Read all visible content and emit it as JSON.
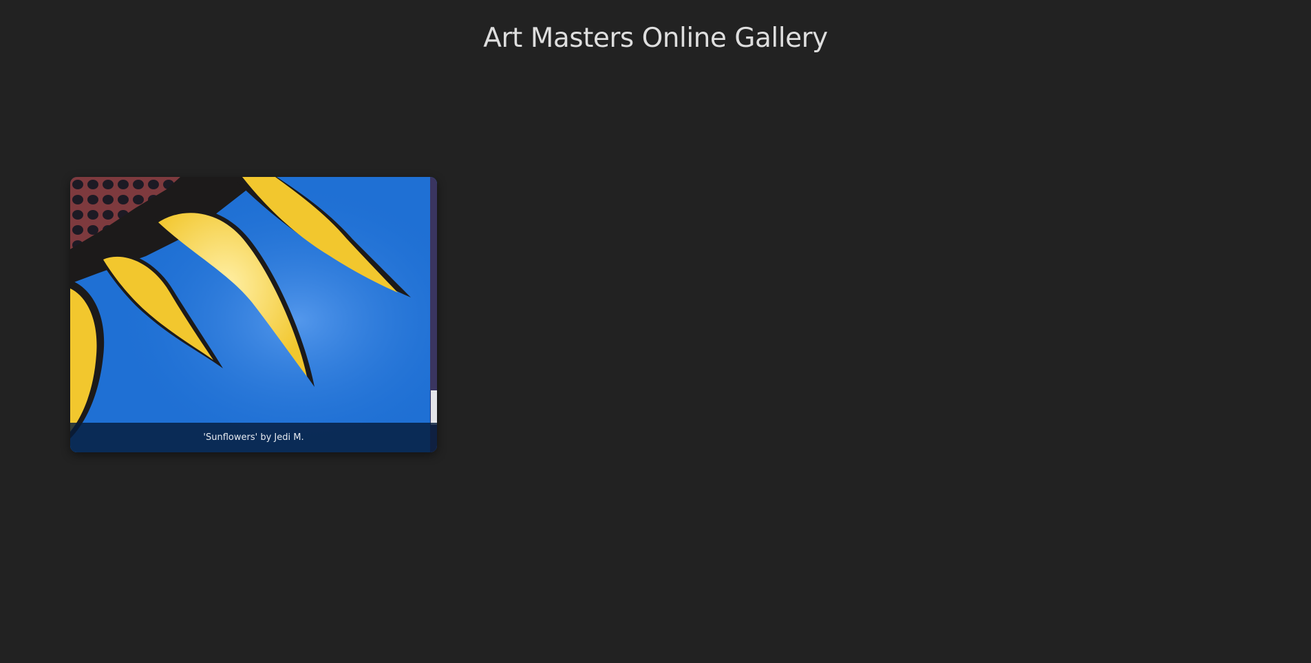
{
  "header": {
    "title": "Art Masters Online Gallery"
  },
  "gallery": {
    "items": [
      {
        "caption": "'Sunflowers' by Jedi M.",
        "image_icon": "sunflower-painting-image"
      }
    ]
  },
  "colors": {
    "background": "#222222",
    "title_text": "#dedede",
    "painting_sky": "#1f70d4",
    "painting_petals": "#f2c72e",
    "painting_outline": "#1c1a1a",
    "painting_center": "#7e3a3e",
    "caption_bar": "#061c3a"
  }
}
